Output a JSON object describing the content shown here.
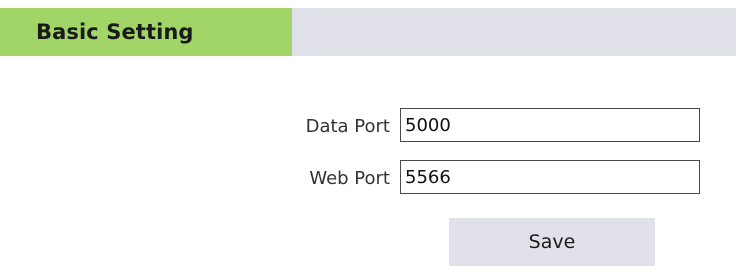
{
  "header": {
    "title": "Basic Setting"
  },
  "form": {
    "data_port": {
      "label": "Data Port",
      "value": "5000"
    },
    "web_port": {
      "label": "Web Port",
      "value": "5566"
    }
  },
  "actions": {
    "save_label": "Save"
  },
  "colors": {
    "header_tab": "#a1d568",
    "header_bar": "#e1e2e9",
    "button_bg": "#e1e2e9"
  }
}
